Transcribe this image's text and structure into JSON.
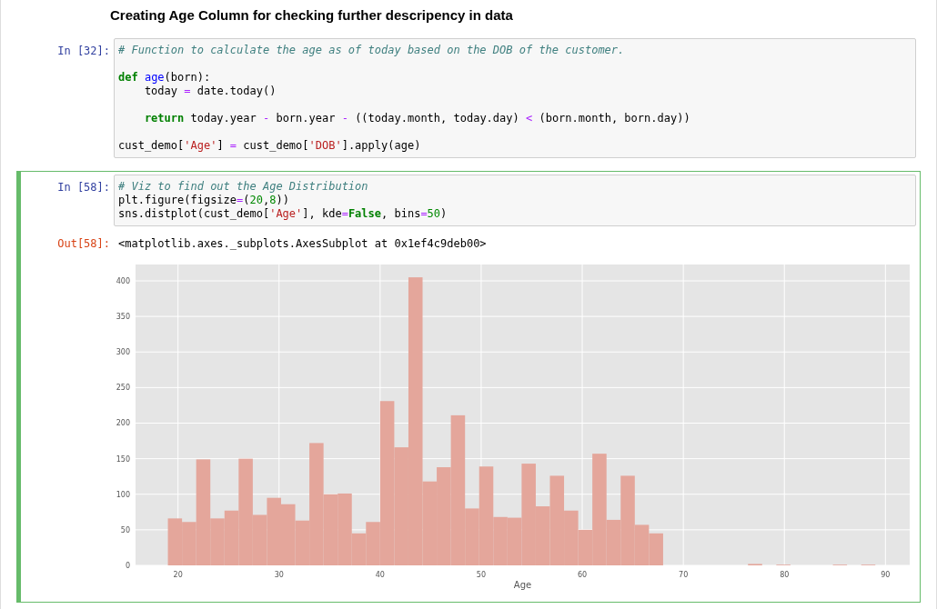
{
  "heading": "Creating Age Column for checking further descripency in data",
  "cells": [
    {
      "prompt": "In [32]:",
      "selected": false,
      "lines": [
        {
          "kind": "code",
          "tokens": [
            {
              "kind": "comment",
              "text": "# Function to calculate the age as of today based on the DOB of the customer."
            }
          ]
        },
        {
          "kind": "blank"
        },
        {
          "kind": "code",
          "tokens": [
            {
              "kind": "keyword",
              "text": "def"
            },
            {
              "kind": "function",
              "text": " age"
            },
            {
              "kind": "plain",
              "text": "(born):"
            }
          ]
        },
        {
          "kind": "code",
          "tokens": [
            {
              "kind": "plain",
              "text": "    today "
            },
            {
              "kind": "operator",
              "text": "="
            },
            {
              "kind": "plain",
              "text": " date.today()"
            }
          ]
        },
        {
          "kind": "blank"
        },
        {
          "kind": "code",
          "tokens": [
            {
              "kind": "keyword",
              "text": "    return"
            },
            {
              "kind": "plain",
              "text": " today.year "
            },
            {
              "kind": "operator",
              "text": "-"
            },
            {
              "kind": "plain",
              "text": " born.year "
            },
            {
              "kind": "operator",
              "text": "-"
            },
            {
              "kind": "plain",
              "text": " ((today.month, today.day) "
            },
            {
              "kind": "operator",
              "text": "<"
            },
            {
              "kind": "plain",
              "text": " (born.month, born.day))"
            }
          ]
        },
        {
          "kind": "blank"
        },
        {
          "kind": "code",
          "tokens": [
            {
              "kind": "plain",
              "text": "cust_demo["
            },
            {
              "kind": "string",
              "text": "'Age'"
            },
            {
              "kind": "plain",
              "text": "] "
            },
            {
              "kind": "operator",
              "text": "="
            },
            {
              "kind": "plain",
              "text": " cust_demo["
            },
            {
              "kind": "string",
              "text": "'DOB'"
            },
            {
              "kind": "plain",
              "text": "].apply(age)"
            }
          ]
        }
      ]
    },
    {
      "prompt": "In [58]:",
      "selected": true,
      "lines": [
        {
          "kind": "code",
          "tokens": [
            {
              "kind": "comment",
              "text": "# Viz to find out the Age Distribution"
            }
          ]
        },
        {
          "kind": "code",
          "tokens": [
            {
              "kind": "plain",
              "text": "plt.figure(figsize"
            },
            {
              "kind": "operator",
              "text": "="
            },
            {
              "kind": "plain",
              "text": "("
            },
            {
              "kind": "number",
              "text": "20"
            },
            {
              "kind": "plain",
              "text": ","
            },
            {
              "kind": "number",
              "text": "8"
            },
            {
              "kind": "plain",
              "text": "))"
            }
          ]
        },
        {
          "kind": "code",
          "tokens": [
            {
              "kind": "plain",
              "text": "sns.distplot(cust_demo["
            },
            {
              "kind": "string",
              "text": "'Age'"
            },
            {
              "kind": "plain",
              "text": "], kde"
            },
            {
              "kind": "operator",
              "text": "="
            },
            {
              "kind": "keyword",
              "text": "False"
            },
            {
              "kind": "plain",
              "text": ", bins"
            },
            {
              "kind": "operator",
              "text": "="
            },
            {
              "kind": "number",
              "text": "50"
            },
            {
              "kind": "plain",
              "text": ")"
            }
          ]
        }
      ],
      "output": {
        "prompt": "Out[58]:",
        "text": "<matplotlib.axes._subplots.AxesSubplot at 0x1ef4c9deb00>",
        "chart_data": {
          "type": "bar",
          "xlabel": "Age",
          "grid": true,
          "x": [
            19.7,
            21.1,
            22.5,
            23.9,
            25.3,
            26.7,
            28.1,
            29.5,
            30.9,
            32.3,
            33.7,
            35.1,
            36.5,
            37.9,
            39.3,
            40.7,
            42.1,
            43.5,
            44.9,
            46.3,
            47.7,
            49.1,
            50.5,
            51.9,
            53.3,
            54.7,
            56.1,
            57.5,
            58.9,
            60.3,
            61.7,
            63.1,
            64.5,
            65.9,
            67.3,
            68.7,
            70.1,
            71.5,
            72.9,
            74.3,
            75.7,
            77.1,
            78.5,
            79.9,
            81.3,
            82.7,
            84.1,
            85.5,
            86.9,
            88.3
          ],
          "series": [
            {
              "color": "#e4a69b",
              "values": [
                66,
                61,
                149,
                66,
                77,
                150,
                71,
                95,
                86,
                63,
                172,
                100,
                101,
                45,
                61,
                231,
                166,
                405,
                118,
                138,
                211,
                80,
                139,
                68,
                67,
                143,
                83,
                126,
                77,
                50,
                157,
                64,
                126,
                57,
                45,
                0,
                0,
                0,
                0,
                0,
                0,
                2,
                0,
                1,
                0,
                0,
                0,
                1,
                0,
                1
              ]
            }
          ],
          "xlim": [
            15.8,
            92.4
          ],
          "ylim": [
            0,
            423
          ],
          "xticks": [
            20,
            30,
            40,
            50,
            60,
            70,
            80,
            90
          ],
          "yticks": [
            0,
            50,
            100,
            150,
            200,
            250,
            300,
            350,
            400
          ]
        }
      }
    }
  ]
}
